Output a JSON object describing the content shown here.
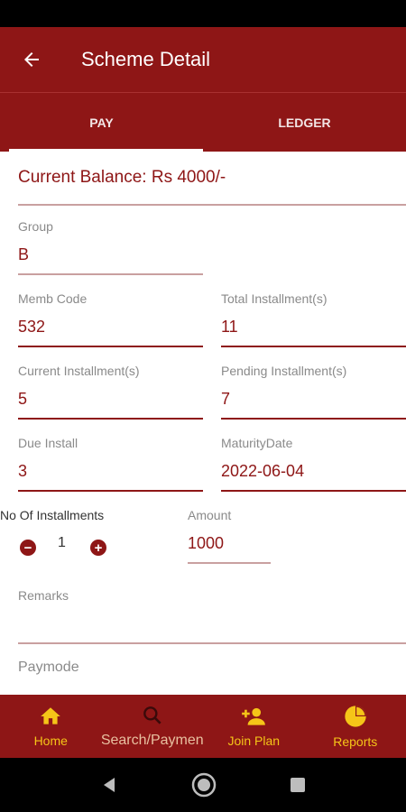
{
  "header": {
    "title": "Scheme Detail"
  },
  "tabs": [
    {
      "label": "PAY"
    },
    {
      "label": "LEDGER"
    }
  ],
  "balance": {
    "text": "Current Balance: Rs 4000/-"
  },
  "fields": {
    "group": {
      "label": "Group",
      "value": "B"
    },
    "memb_code": {
      "label": "Memb Code",
      "value": "532"
    },
    "total_installments": {
      "label": "Total Installment(s)",
      "value": "11"
    },
    "current_installment": {
      "label": "Current Installment(s)",
      "value": "5"
    },
    "pending_installments": {
      "label": "Pending Installment(s)",
      "value": "7"
    },
    "due_install": {
      "label": "Due Install",
      "value": "3"
    },
    "maturity_date": {
      "label": "MaturityDate",
      "value": "2022-06-04"
    },
    "no_of_installments": {
      "label": "No Of Installments",
      "value": "1",
      "minus": "−",
      "plus": "+"
    },
    "amount": {
      "label": "Amount",
      "value": "1000"
    },
    "remarks": {
      "label": "Remarks"
    },
    "paymode": {
      "label": "Paymode"
    }
  },
  "bottom_nav": [
    {
      "label": "Home",
      "icon": "home-icon"
    },
    {
      "label": "Search/Paymen",
      "icon": "search-icon"
    },
    {
      "label": "Join Plan",
      "icon": "add-person-icon"
    },
    {
      "label": "Reports",
      "icon": "pie-chart-icon"
    }
  ],
  "colors": {
    "primary": "#8e1616",
    "accent": "#f5c518"
  }
}
